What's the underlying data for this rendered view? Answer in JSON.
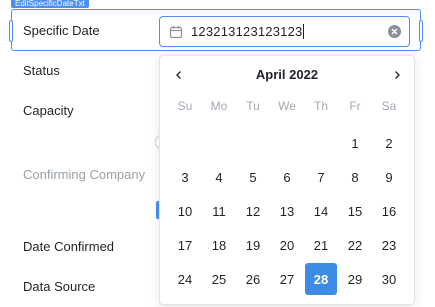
{
  "component_tag": "EditSpecificDateTxt",
  "fields": {
    "specific_date": "Specific Date",
    "status": "Status",
    "capacity": "Capacity",
    "confirming_company": "Confirming Company",
    "date_confirmed": "Date Confirmed",
    "data_source": "Data Source"
  },
  "date_input": {
    "value": "123213123123123"
  },
  "calendar": {
    "month_title": "April 2022",
    "weekdays": [
      "Su",
      "Mo",
      "Tu",
      "We",
      "Th",
      "Fr",
      "Sa"
    ],
    "days": [
      "",
      "",
      "",
      "",
      "",
      "1",
      "2",
      "3",
      "4",
      "5",
      "6",
      "7",
      "8",
      "9",
      "10",
      "11",
      "12",
      "13",
      "14",
      "15",
      "16",
      "17",
      "18",
      "19",
      "20",
      "21",
      "22",
      "23",
      "24",
      "25",
      "26",
      "27",
      "28",
      "29",
      "30"
    ],
    "selected_day": "28"
  },
  "icons": {
    "calendar": "calendar-icon",
    "clear": "clear-circle-icon",
    "prev": "chevron-left-icon",
    "next": "chevron-right-icon"
  },
  "colors": {
    "accent": "#4b8ff0",
    "selected_day": "#3d8be4"
  }
}
